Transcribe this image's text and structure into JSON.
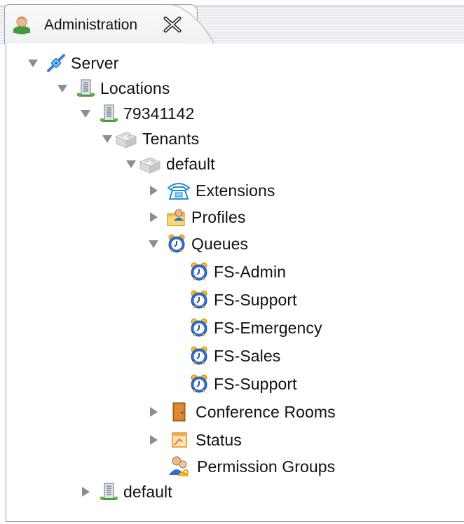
{
  "tab": {
    "title": "Administration"
  },
  "tree": {
    "server": "Server",
    "locations": "Locations",
    "location_id": "79341142",
    "tenants": "Tenants",
    "tenant_default": "default",
    "extensions": "Extensions",
    "profiles": "Profiles",
    "queues": "Queues",
    "queue_items": [
      "FS-Admin",
      "FS-Support",
      "FS-Emergency",
      "FS-Sales",
      "FS-Support"
    ],
    "conference_rooms": "Conference Rooms",
    "status": "Status",
    "permission_groups": "Permission Groups",
    "location_default": "default"
  },
  "icons": {
    "tab": "administrator-icon",
    "close": "close-icon",
    "expanded": "triangle-down-icon",
    "collapsed": "triangle-right-icon"
  },
  "colors": {
    "tab_border": "#9a9ea5",
    "queue_icon": "#2f6fcf",
    "phone_icon": "#1f8fd6",
    "door_icon": "#c9721f"
  }
}
